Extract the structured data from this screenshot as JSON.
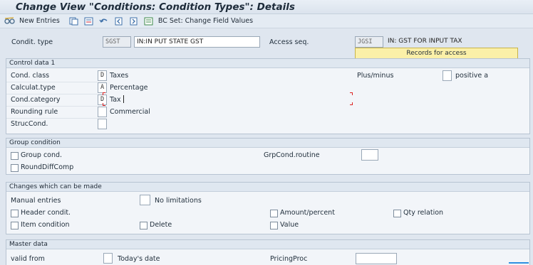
{
  "title": "Change View \"Conditions: Condition Types\": Details",
  "toolbar": {
    "new_entries": "New Entries",
    "bc_set": "BC Set: Change Field Values",
    "icons": [
      "edit-glasses-icon",
      "copy-icon",
      "delete-icon",
      "undo-icon",
      "previous-icon",
      "next-icon",
      "select-icon"
    ]
  },
  "header": {
    "condit_type_label": "Condit. type",
    "condit_type_code": "SGST",
    "condit_type_desc": "IN:IN PUT STATE GST",
    "access_seq_label": "Access seq.",
    "access_seq_code": "JGSI",
    "access_seq_desc": "IN: GST FOR INPUT TAX",
    "records_button": "Records for access"
  },
  "control_data": {
    "title": "Control data 1",
    "rows": [
      {
        "label": "Cond. class",
        "value": "D",
        "text": "Taxes"
      },
      {
        "label": "Calculat.type",
        "value": "A",
        "text": "Percentage"
      },
      {
        "label": "Cond.category",
        "value": "D",
        "text": "Tax"
      },
      {
        "label": "Rounding rule",
        "value": "",
        "text": "Commercial"
      },
      {
        "label": "StrucCond.",
        "value": "",
        "text": ""
      }
    ],
    "plus_minus_label": "Plus/minus",
    "plus_minus_text": "positive a"
  },
  "group_condition": {
    "title": "Group condition",
    "group_cond": "Group cond.",
    "round_diff": "RoundDiffComp",
    "grpcond_routine_label": "GrpCond.routine"
  },
  "changes": {
    "title": "Changes which can be made",
    "manual_entries_label": "Manual entries",
    "manual_entries_text": "No limitations",
    "header_condit": "Header condit.",
    "item_condition": "Item condition",
    "delete": "Delete",
    "amount_percent": "Amount/percent",
    "value": "Value",
    "qty_relation": "Qty relation"
  },
  "master_data": {
    "title": "Master data",
    "valid_from_label": "valid from",
    "valid_from_text": "Today's date",
    "pricing_proc_label": "PricingProc"
  },
  "colors": {
    "background": "#dfe6ef",
    "records_button": "#fbf0a8"
  }
}
